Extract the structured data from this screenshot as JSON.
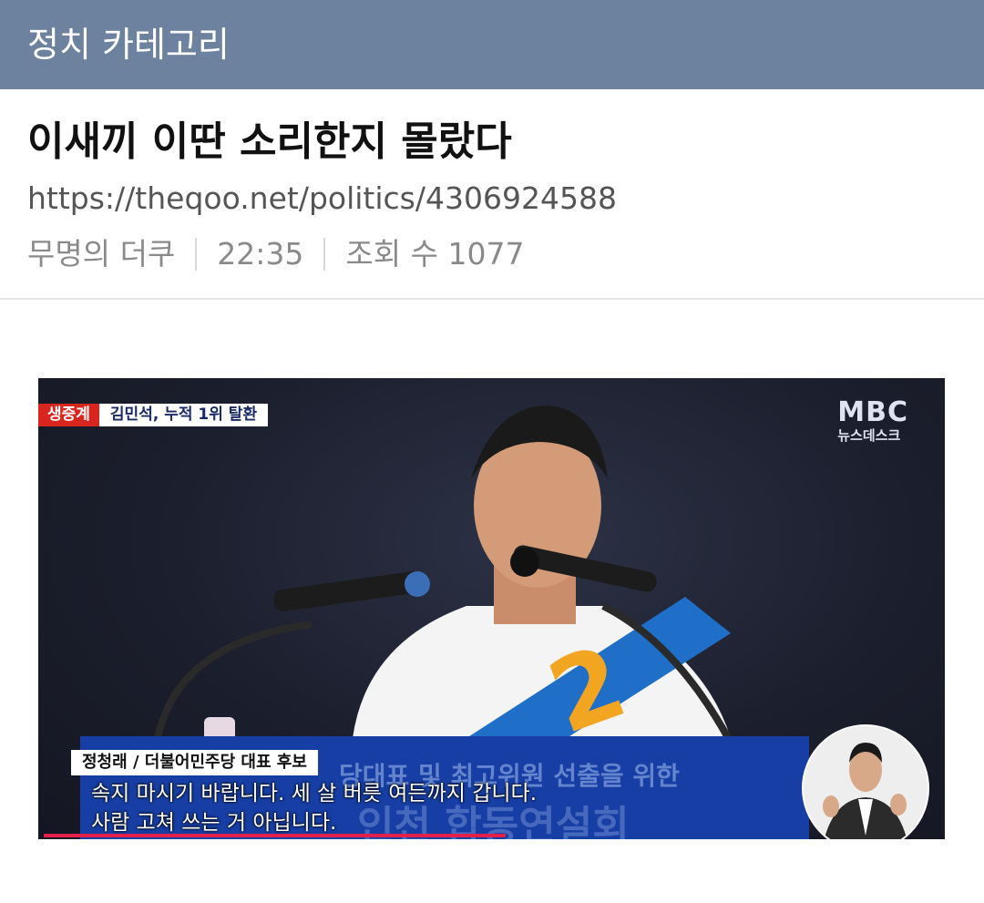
{
  "header": {
    "title": "정치 카테고리"
  },
  "post": {
    "title": "이새끼 이딴 소리한지 몰랐다",
    "url": "https://theqoo.net/politics/4306924588",
    "author": "무명의 더쿠",
    "time": "22:35",
    "views": "조회 수 1077"
  },
  "video": {
    "live_label": "생중계",
    "headline": "김민석, 누적 1위 탈환",
    "logo_main": "MBC",
    "logo_sub": "뉴스데스크",
    "podium_line1": "당대표 및 최고위원 선출을 위한",
    "podium_line2": "인천 합동연설회",
    "speaker": "정청래 / 더불어민주당 대표 후보",
    "subtitle_line1": "속지 마시기 바랍니다. 세 살 버릇 여든까지 갑니다.",
    "subtitle_line2": "사람 고쳐 쓰는 거 아닙니다.",
    "sash_number": "2",
    "progress": 0.51,
    "colors": {
      "live_red": "#d8261f",
      "podium_blue": "#173ea4",
      "progress_red": "#e3204a"
    }
  }
}
